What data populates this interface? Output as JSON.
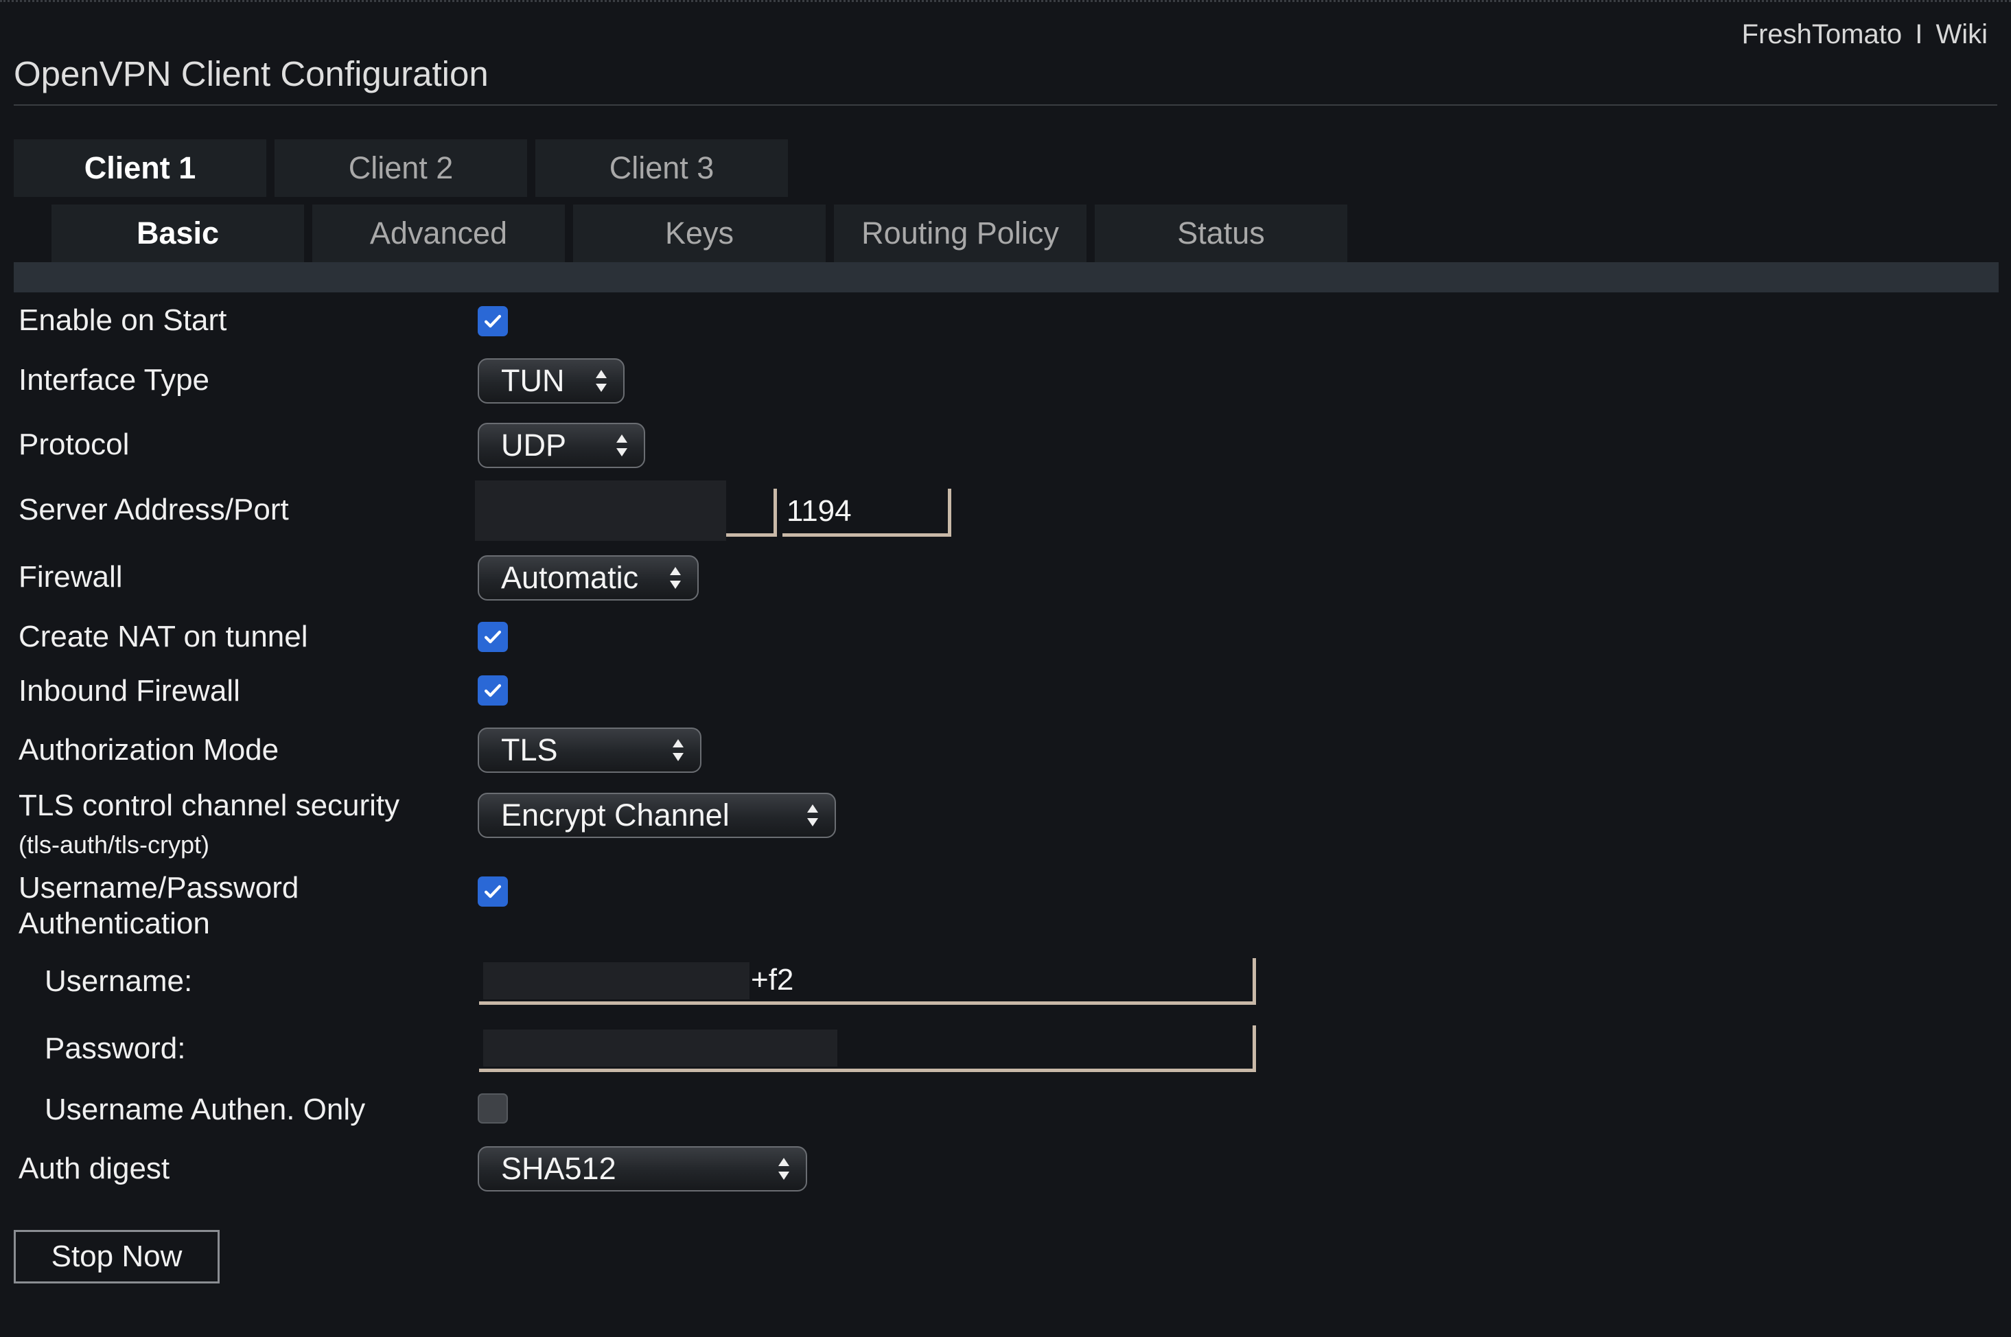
{
  "header": {
    "brand": "FreshTomato",
    "separator": "I",
    "wiki": "Wiki",
    "title": "OpenVPN Client Configuration"
  },
  "client_tabs": [
    {
      "label": "Client 1",
      "active": true
    },
    {
      "label": "Client 2",
      "active": false
    },
    {
      "label": "Client 3",
      "active": false
    }
  ],
  "section_tabs": [
    {
      "label": "Basic",
      "active": true
    },
    {
      "label": "Advanced",
      "active": false
    },
    {
      "label": "Keys",
      "active": false
    },
    {
      "label": "Routing Policy",
      "active": false
    },
    {
      "label": "Status",
      "active": false
    }
  ],
  "form": {
    "enable_on_start": {
      "label": "Enable on Start",
      "checked": true
    },
    "interface_type": {
      "label": "Interface Type",
      "value": "TUN"
    },
    "protocol": {
      "label": "Protocol",
      "value": "UDP"
    },
    "server": {
      "label": "Server Address/Port",
      "address": "",
      "port": "1194"
    },
    "firewall": {
      "label": "Firewall",
      "value": "Automatic"
    },
    "create_nat": {
      "label": "Create NAT on tunnel",
      "checked": true
    },
    "inbound_firewall": {
      "label": "Inbound Firewall",
      "checked": true
    },
    "auth_mode": {
      "label": "Authorization Mode",
      "value": "TLS"
    },
    "tls_security": {
      "label": "TLS control channel security",
      "sublabel": "(tls-auth/tls-crypt)",
      "value": "Encrypt Channel"
    },
    "userpass_auth": {
      "label_line1": "Username/Password",
      "label_line2": "Authentication",
      "checked": true
    },
    "username": {
      "label": "Username:",
      "value": "+f2"
    },
    "password": {
      "label": "Password:",
      "value": ""
    },
    "username_only": {
      "label": "Username Authen. Only",
      "checked": false
    },
    "auth_digest": {
      "label": "Auth digest",
      "value": "SHA512"
    }
  },
  "actions": {
    "stop_now": "Stop Now"
  },
  "colors": {
    "background": "#131519",
    "tab_background": "#1d2125",
    "checkbox_blue": "#2a68d6",
    "input_border": "#c9b9a8"
  }
}
